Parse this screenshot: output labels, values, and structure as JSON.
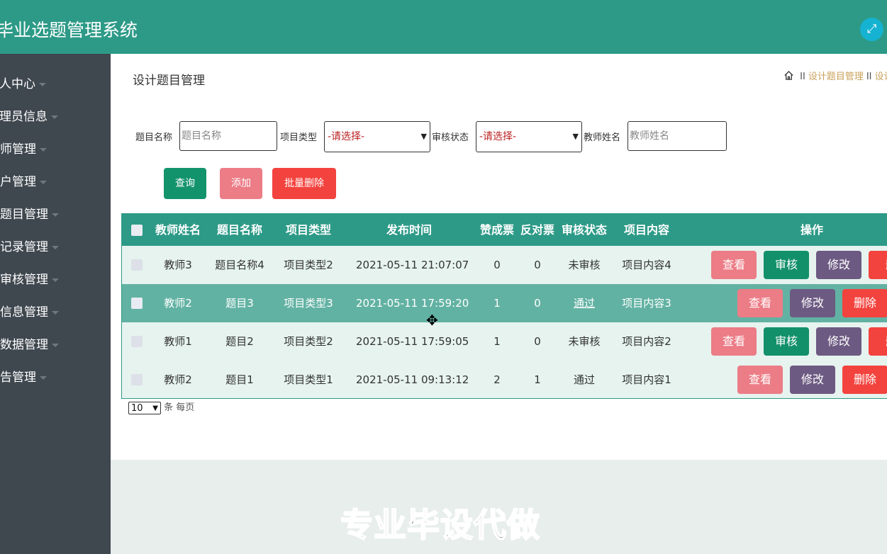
{
  "app": {
    "title": "毕业选题管理系统"
  },
  "sidebar": {
    "items": [
      {
        "label": "人中心"
      },
      {
        "label": "理员信息"
      },
      {
        "label": "师管理"
      },
      {
        "label": "户管理"
      },
      {
        "label": "题目管理"
      },
      {
        "label": "记录管理"
      },
      {
        "label": "审核管理"
      },
      {
        "label": "信息管理"
      },
      {
        "label": "数据管理"
      },
      {
        "label": "告管理"
      }
    ]
  },
  "page": {
    "title": "设计题目管理",
    "breadcrumb": {
      "sep": "II",
      "current": "设计题目管理",
      "next": "设计"
    }
  },
  "filters": {
    "topic_label": "题目名称",
    "topic_placeholder": "题目名称",
    "type_label": "项目类型",
    "type_value": "-请选择-",
    "status_label": "审核状态",
    "status_value": "-请选择-",
    "teacher_label": "教师姓名",
    "teacher_placeholder": "教师姓名"
  },
  "actions": {
    "query": "查询",
    "add": "添加",
    "batch_delete": "批量删除"
  },
  "table": {
    "headers": [
      "教师姓名",
      "题目名称",
      "项目类型",
      "发布时间",
      "赞成票",
      "反对票",
      "审核状态",
      "项目内容",
      "操作"
    ],
    "rows": [
      {
        "teacher": "教师3",
        "topic": "题目名称4",
        "type": "项目类型2",
        "time": "2021-05-11 21:07:07",
        "yes": "0",
        "no": "0",
        "status": "未审核",
        "content": "项目内容4"
      },
      {
        "teacher": "教师2",
        "topic": "题目3",
        "type": "项目类型3",
        "time": "2021-05-11 17:59:20",
        "yes": "1",
        "no": "0",
        "status": "通过",
        "content": "项目内容3"
      },
      {
        "teacher": "教师1",
        "topic": "题目2",
        "type": "项目类型2",
        "time": "2021-05-11 17:59:05",
        "yes": "1",
        "no": "0",
        "status": "未审核",
        "content": "项目内容2"
      },
      {
        "teacher": "教师2",
        "topic": "题目1",
        "type": "项目类型1",
        "time": "2021-05-11 09:13:12",
        "yes": "2",
        "no": "1",
        "status": "通过",
        "content": "项目内容1"
      }
    ],
    "row_actions": {
      "view": "查看",
      "audit": "审核",
      "edit": "修改",
      "delete": "删除",
      "delete_cut": "删"
    }
  },
  "pager": {
    "page_size": "10",
    "suffix": "条 每页"
  },
  "watermark": "专业毕设代做",
  "icons": {
    "fullscreen": "expand-icon",
    "home": "home-icon",
    "cursor": "move-cursor-icon"
  },
  "colors": {
    "primary": "#2d9a87",
    "sidebar": "#3f474f",
    "view": "#ec7c86",
    "audit": "#12906a",
    "edit": "#6d5a82",
    "delete": "#f3433e"
  }
}
